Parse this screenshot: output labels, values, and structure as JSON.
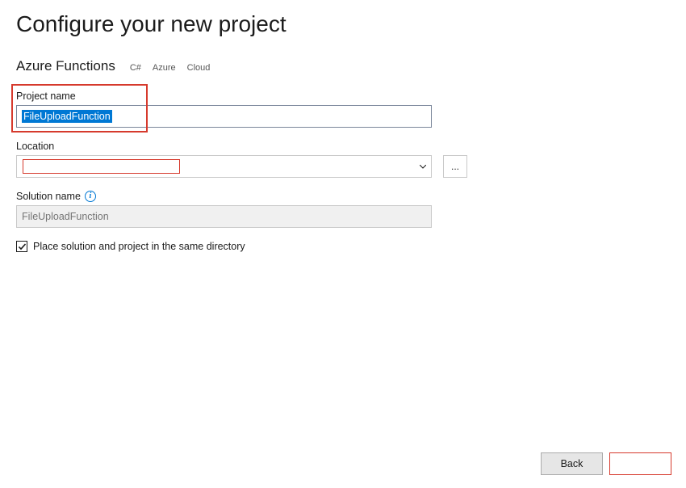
{
  "header": {
    "title": "Configure your new project",
    "project_type": "Azure Functions",
    "tags": [
      "C#",
      "Azure",
      "Cloud"
    ]
  },
  "fields": {
    "project_name": {
      "label": "Project name",
      "value": "FileUploadFunction"
    },
    "location": {
      "label": "Location",
      "value": "",
      "browse_label": "..."
    },
    "solution_name": {
      "label": "Solution name",
      "placeholder": "FileUploadFunction"
    },
    "same_directory": {
      "label": "Place solution and project in the same directory",
      "checked": true
    }
  },
  "footer": {
    "back": "Back"
  }
}
